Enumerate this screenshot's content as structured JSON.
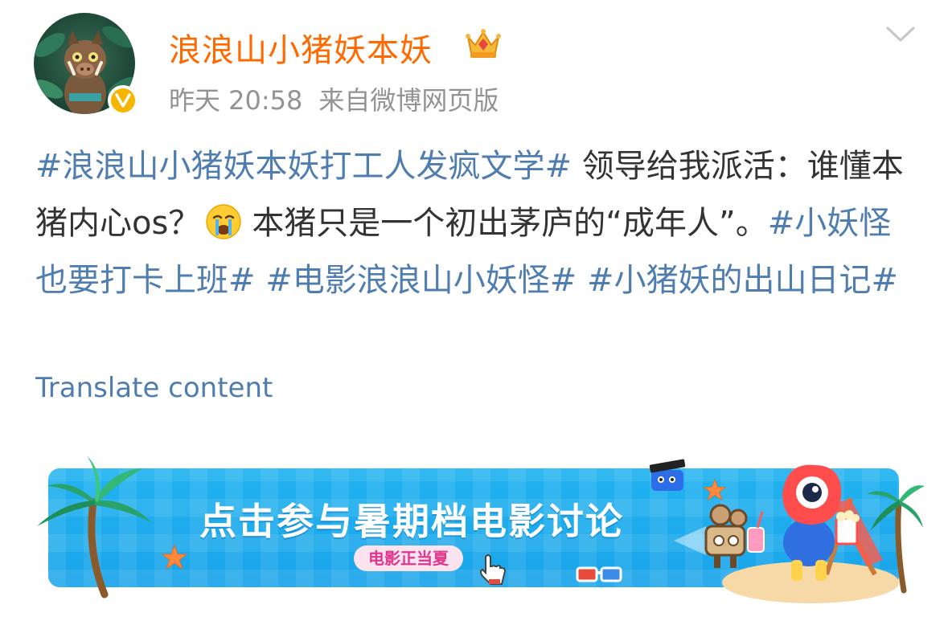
{
  "user": {
    "name": "浪浪山小猪妖本妖",
    "timestamp": "昨天 20:58",
    "source": "来自微博网页版"
  },
  "post": {
    "topic1": "#浪浪山小猪妖本妖打工人发疯文学#",
    "text1": " 领导给我派活：谁懂本猪内心os？",
    "text2": "本猪只是一个初出茅庐的“成年人”。",
    "topic2": "#小妖怪也要打卡上班#",
    "topic3": "#电影浪浪山小妖怪#",
    "topic4": "#小猪妖的出山日记#"
  },
  "translate_label": "Translate content",
  "banner": {
    "title": "点击参与暑期档电影讨论",
    "pill": "电影正当夏"
  },
  "colors": {
    "username": "#ff6a00",
    "topic": "#507daf",
    "meta": "#939393",
    "banner": "#1aa4ea"
  },
  "icons": [
    "avatar-boar",
    "verified-badge-icon",
    "crown-icon",
    "chevron-down-icon",
    "crying-emoji-icon",
    "palm-tree-icon",
    "starfish-icon",
    "film-camera-icon",
    "mascot-icon",
    "3d-glasses-icon",
    "pointer-hand-icon",
    "clapperboard-icon"
  ]
}
